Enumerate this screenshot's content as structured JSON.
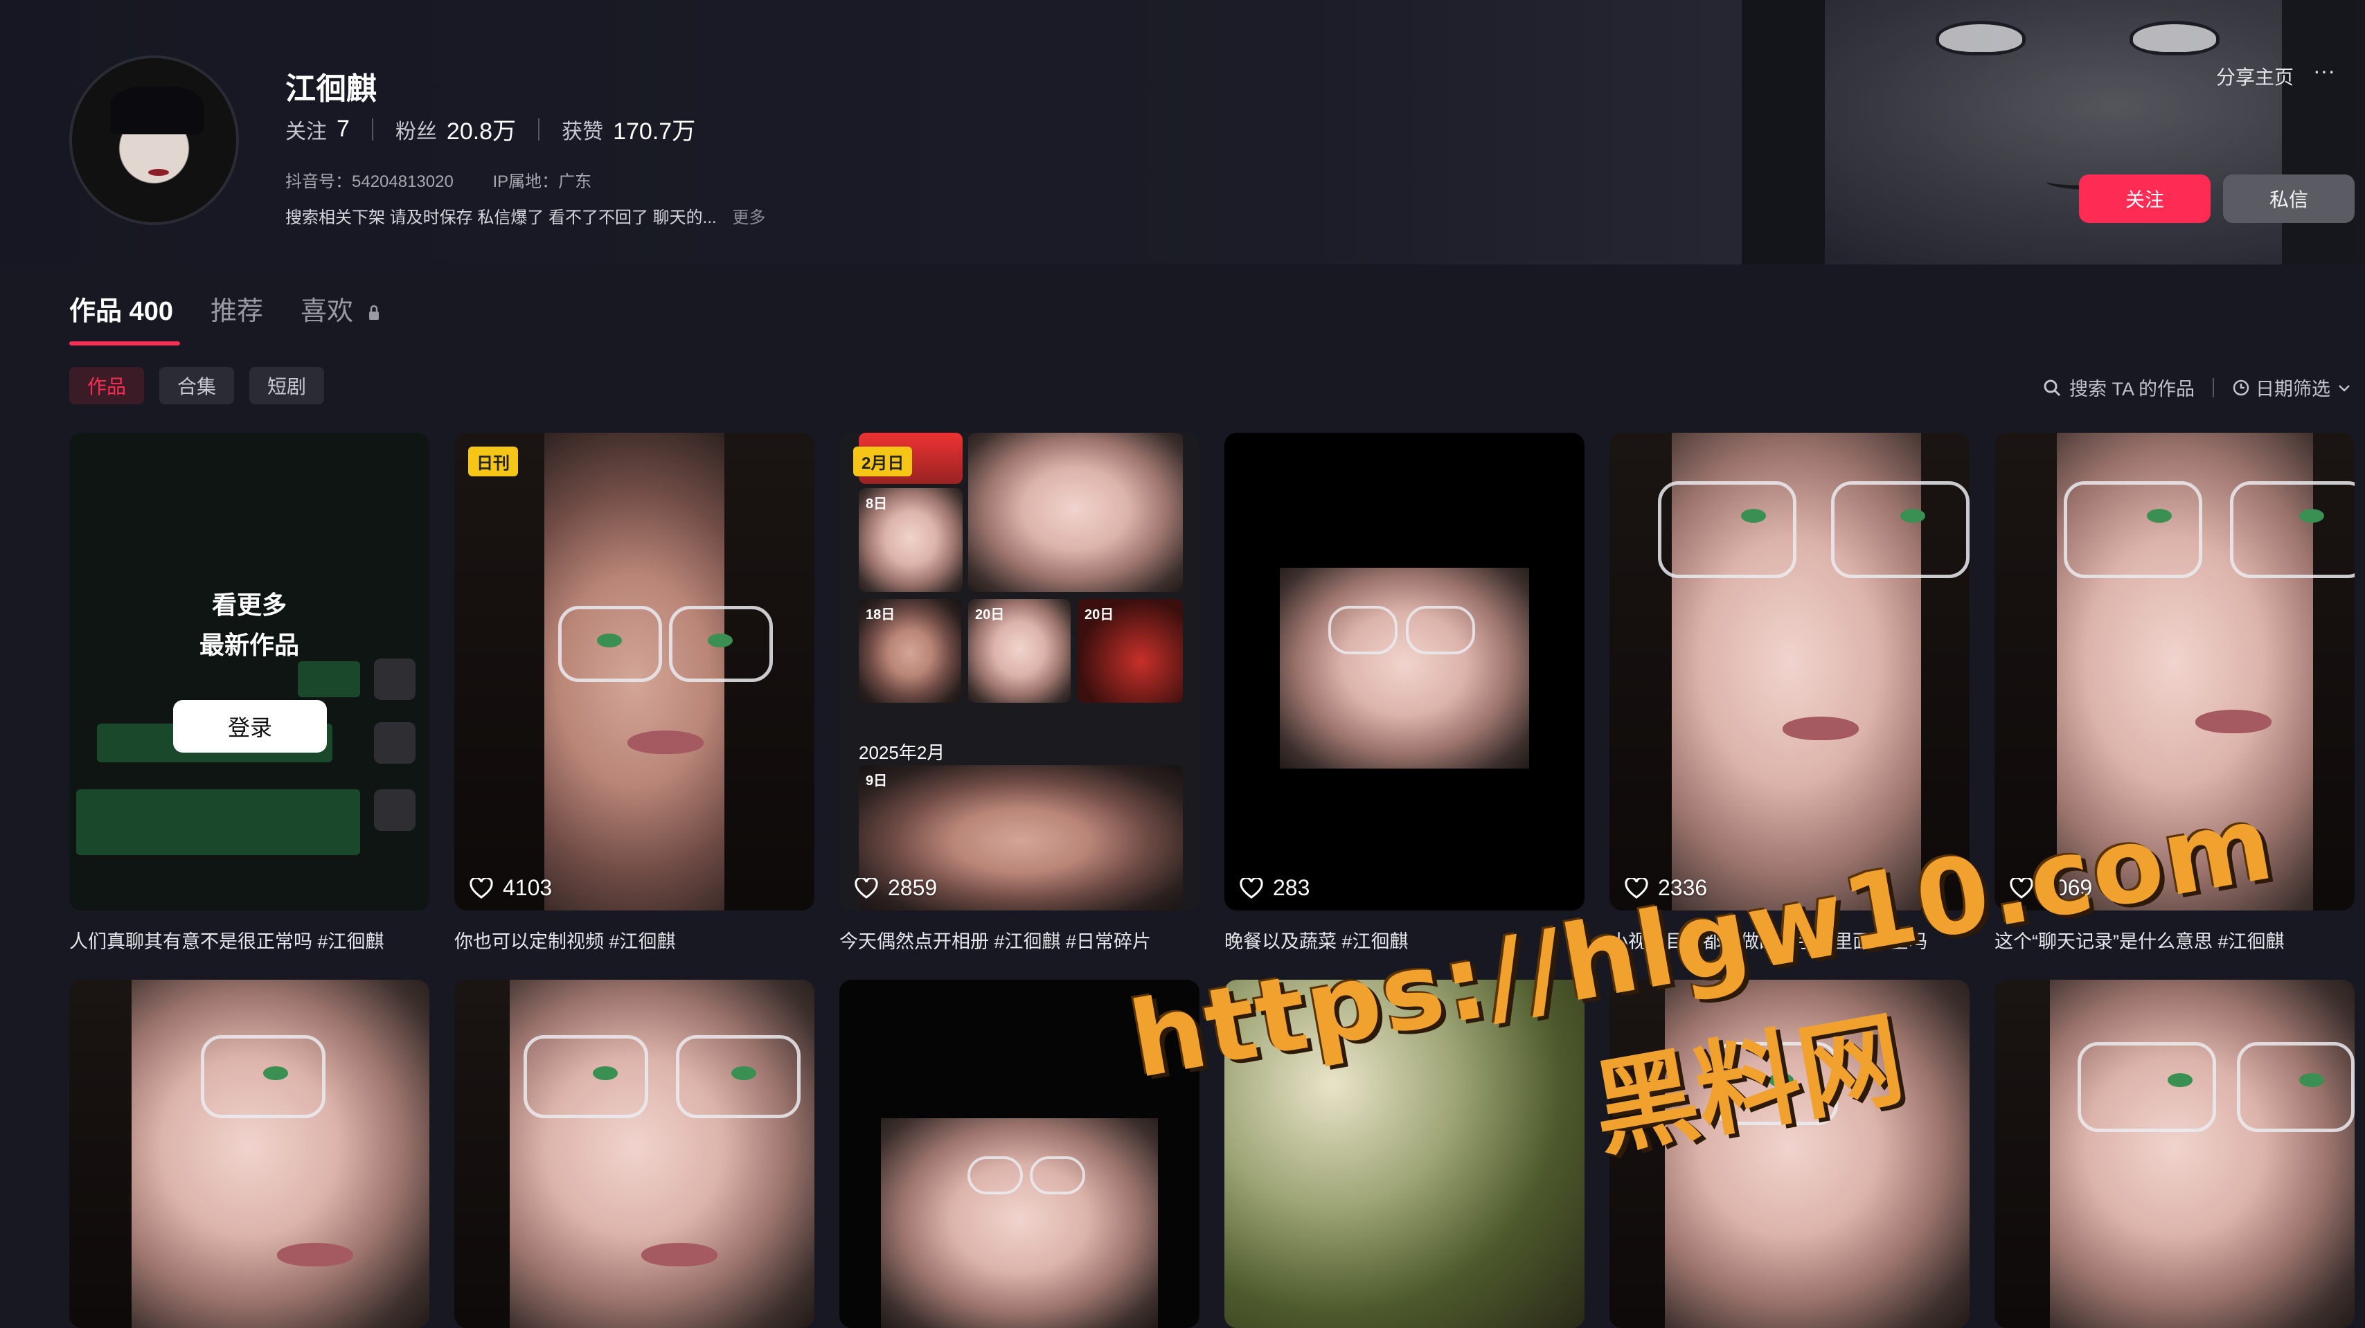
{
  "profile": {
    "name": "江徊麒",
    "following_label": "关注",
    "following_value": "7",
    "followers_label": "粉丝",
    "followers_value": "20.8万",
    "likes_label": "获赞",
    "likes_value": "170.7万",
    "id_text": "抖音号：54204813020",
    "ip_text": "IP属地：广东",
    "bio_text": "搜索相关下架 请及时保存 私信爆了 看不了不回了 聊天的...",
    "bio_more": "更多"
  },
  "header": {
    "share_label": "分享主页",
    "more_icon": "···",
    "follow_button": "关注",
    "message_button": "私信"
  },
  "tabs": [
    {
      "label": "作品 400"
    },
    {
      "label": "推荐"
    },
    {
      "label": "喜欢"
    }
  ],
  "chips": [
    {
      "label": "作品"
    },
    {
      "label": "合集"
    },
    {
      "label": "短剧"
    }
  ],
  "tools": {
    "search_label": "搜索 TA 的作品",
    "filter_label": "日期筛选"
  },
  "login_card": {
    "title": "看更多\n最新作品",
    "button": "登录"
  },
  "videos": [
    {
      "caption": "人们真聊其有意不是很正常吗 #江徊麒",
      "likes": ""
    },
    {
      "caption": "你也可以定制视频 #江徊麒",
      "likes": "4103",
      "tag": "日刊"
    },
    {
      "caption": "今天偶然点开相册 #江徊麒 #日常碎片",
      "likes": "2859",
      "tag": "2月日"
    },
    {
      "caption": "晚餐以及蔬菜 #江徊麒",
      "likes": "283"
    },
    {
      "caption": "小视频目前都在做的小手机里面安全吗",
      "likes": "2336"
    },
    {
      "caption": "这个“聊天记录”是什么意思 #江徊麒",
      "likes": "1069"
    }
  ],
  "collage": {
    "labels": [
      "8日",
      "18日",
      "20日",
      "20日",
      "9日"
    ],
    "date_text": "2025年2月"
  },
  "watermark": {
    "url": "https://hlgw10.com",
    "cn": "黑料网"
  },
  "colors": {
    "accent": "#fe2c55",
    "background": "#171821",
    "watermark": "#f0a12e"
  }
}
